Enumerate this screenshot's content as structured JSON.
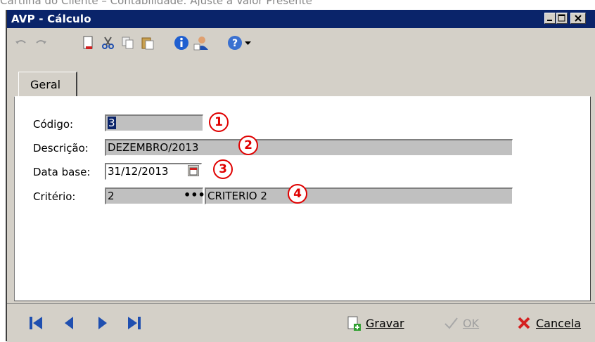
{
  "top_caption": "Cartilha do Cliente – Contabilidade: Ajuste a Valor Presente",
  "window": {
    "title": "AVP - Cálculo",
    "title_buttons": [
      "minimize-icon",
      "maximize-icon",
      "close-icon"
    ]
  },
  "toolbar": {
    "buttons": [
      "undo-icon",
      "redo-icon",
      "new-document-icon",
      "cut-icon",
      "copy-icon",
      "paste-icon",
      "info-icon",
      "user-icon",
      "help-icon",
      "dropdown-arrow-icon"
    ]
  },
  "tabs": [
    {
      "label": "Geral"
    }
  ],
  "form": {
    "codigo": {
      "label": "Código:",
      "value": "3",
      "marker": "1"
    },
    "descricao": {
      "label": "Descrição:",
      "value": "DEZEMBRO/2013",
      "marker": "2"
    },
    "data_base": {
      "label": "Data base:",
      "value": "31/12/2013",
      "marker": "3"
    },
    "criterio": {
      "label": "Critério:",
      "code": "2",
      "lookup_label": "•••",
      "description": "CRITERIO 2",
      "marker": "4"
    }
  },
  "footer": {
    "nav": [
      "first-record-icon",
      "previous-record-icon",
      "next-record-icon",
      "last-record-icon"
    ],
    "gravar_label": "Gravar",
    "ok_label": "OK",
    "cancela_label": "Cancela"
  },
  "colors": {
    "titlebar": "#0a246a",
    "marker": "#e00000",
    "nav_blue": "#1f4fb0",
    "cancel_red": "#d42020"
  }
}
